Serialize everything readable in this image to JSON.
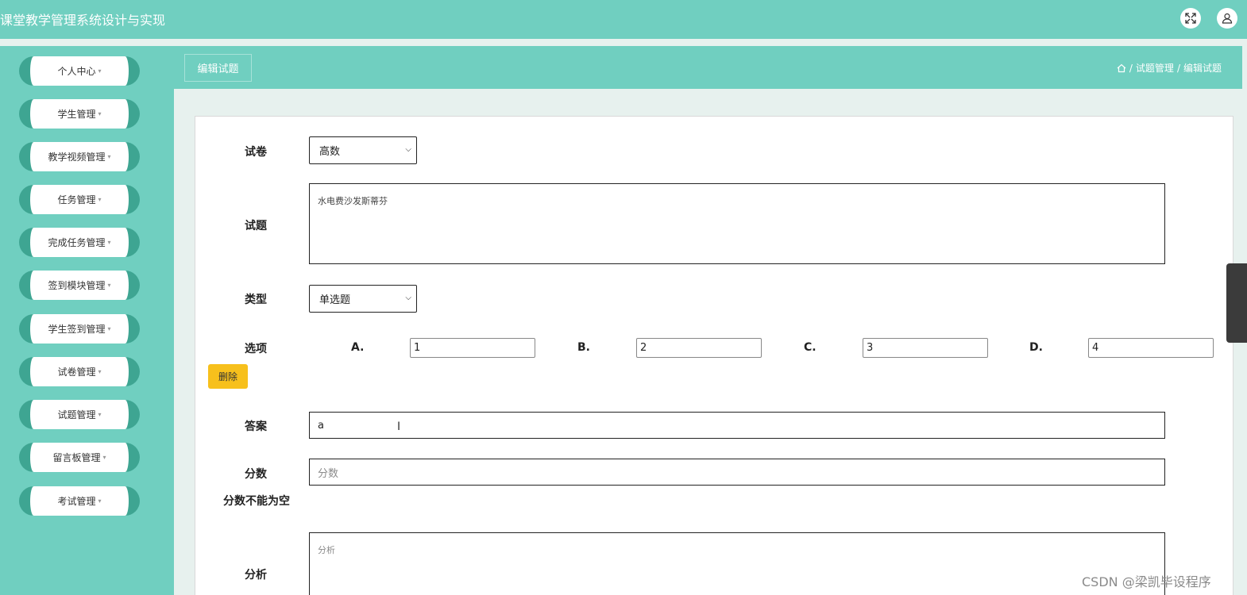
{
  "header": {
    "title": "课堂教学管理系统设计与实现",
    "fullscreen_icon": "expand-icon",
    "user_icon": "user-icon"
  },
  "sidebar": {
    "items": [
      {
        "label": "个人中心"
      },
      {
        "label": "学生管理"
      },
      {
        "label": "教学视频管理"
      },
      {
        "label": "任务管理"
      },
      {
        "label": "完成任务管理"
      },
      {
        "label": "签到模块管理"
      },
      {
        "label": "学生签到管理"
      },
      {
        "label": "试卷管理"
      },
      {
        "label": "试题管理"
      },
      {
        "label": "留言板管理"
      },
      {
        "label": "考试管理"
      }
    ],
    "caret": "▾"
  },
  "breadcrumb": {
    "page_title": "编辑试题",
    "home_icon": "home-icon",
    "separator": "/",
    "path": [
      "试题管理",
      "编辑试题"
    ]
  },
  "form": {
    "paper": {
      "label": "试卷",
      "value": "高数"
    },
    "question": {
      "label": "试题",
      "value": "水电费沙发斯蒂芬"
    },
    "type": {
      "label": "类型",
      "value": "单选题"
    },
    "options": {
      "label": "选项",
      "items": [
        {
          "key": "A.",
          "value": "1"
        },
        {
          "key": "B.",
          "value": "2"
        },
        {
          "key": "C.",
          "value": "3"
        },
        {
          "key": "D.",
          "value": "4"
        }
      ],
      "delete_label": "删除"
    },
    "answer": {
      "label": "答案",
      "value": "a"
    },
    "score": {
      "label": "分数",
      "placeholder": "分数",
      "error": "分数不能为空"
    },
    "analysis": {
      "label": "分析",
      "placeholder": "分析"
    }
  },
  "watermark": "CSDN @梁凯毕设程序",
  "colors": {
    "primary": "#70cfc0",
    "accent": "#3ea592",
    "button_yellow": "#f7c01c"
  }
}
